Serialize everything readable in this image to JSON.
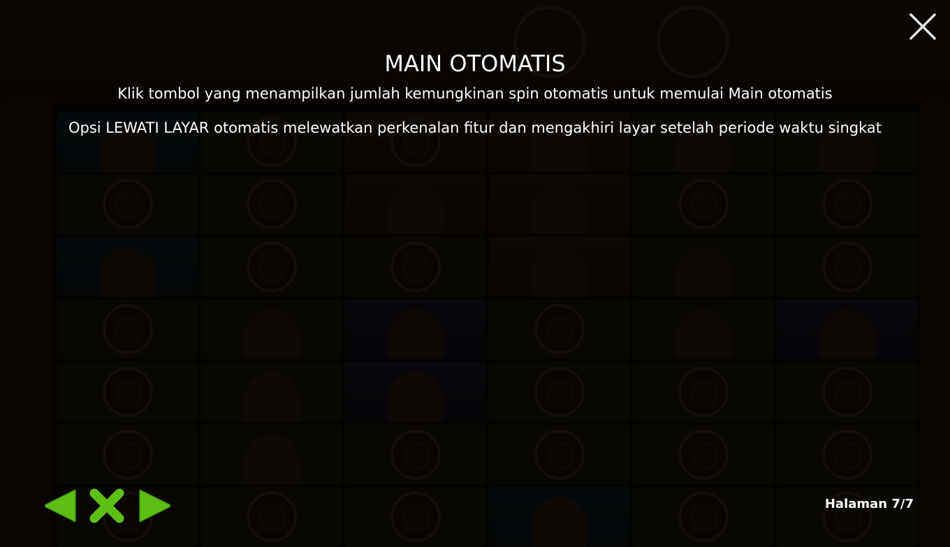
{
  "screen": {
    "title": "MAIN OTOMATIS",
    "lines": [
      "Klik tombol yang menampilkan jumlah kemungkinan spin otomatis untuk memulai Main otomatis",
      "Opsi LEWATI LAYAR otomatis melewatkan perkenalan fitur dan mengakhiri layar setelah periode waktu singkat"
    ]
  },
  "navigation": {
    "prev_icon": "arrow-left-icon",
    "exit_icon": "x-icon",
    "next_icon": "arrow-right-icon",
    "close_icon": "close-icon",
    "page_label": "Halaman 7/7",
    "accent_color": "#5fbf16"
  }
}
